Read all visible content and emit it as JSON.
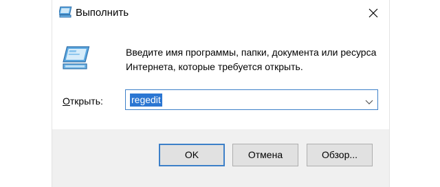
{
  "window": {
    "title": "Выполнить",
    "title_icon": "run-dialog-icon",
    "close_icon": "close-icon"
  },
  "content": {
    "icon": "run-dialog-icon",
    "description": "Введите имя программы, папки, документа или ресурса Интернета, которые требуется открыть.",
    "open_label_accesskey": "О",
    "open_label_rest": "ткрыть:",
    "open_value": "regedit",
    "dropdown_icon": "chevron-down-icon"
  },
  "buttons": {
    "ok": "OK",
    "cancel": "Отмена",
    "browse": "Обзор..."
  },
  "colors": {
    "accent": "#3c7fc8",
    "selection": "#2b76d2",
    "footer_bg": "#f0f0f0"
  }
}
